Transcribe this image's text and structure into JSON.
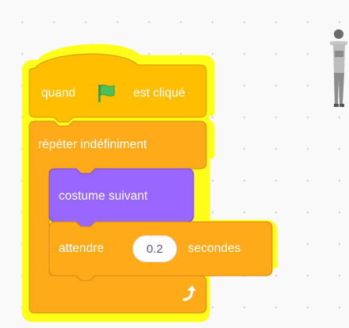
{
  "workspace": {
    "background_color": "#f9f9f9",
    "grid_dot_color": "#d6d6d6"
  },
  "colors": {
    "events": "#ffbf00",
    "control": "#ffab19",
    "looks": "#9966ff",
    "highlight": "#ffff00",
    "green_flag": "#4cbf56"
  },
  "script": {
    "hat_block": {
      "prefix": "quand",
      "icon": "green-flag-icon",
      "suffix": "est cliqué"
    },
    "forever_block": {
      "label": "répéter indéfiniment",
      "loop_icon": "loop-arrow-icon"
    },
    "next_costume_block": {
      "label": "costume suivant"
    },
    "wait_block": {
      "prefix": "attendre",
      "value": "0.2",
      "suffix": "secondes"
    }
  },
  "sprite": {
    "icon": "person-sprite-icon"
  }
}
